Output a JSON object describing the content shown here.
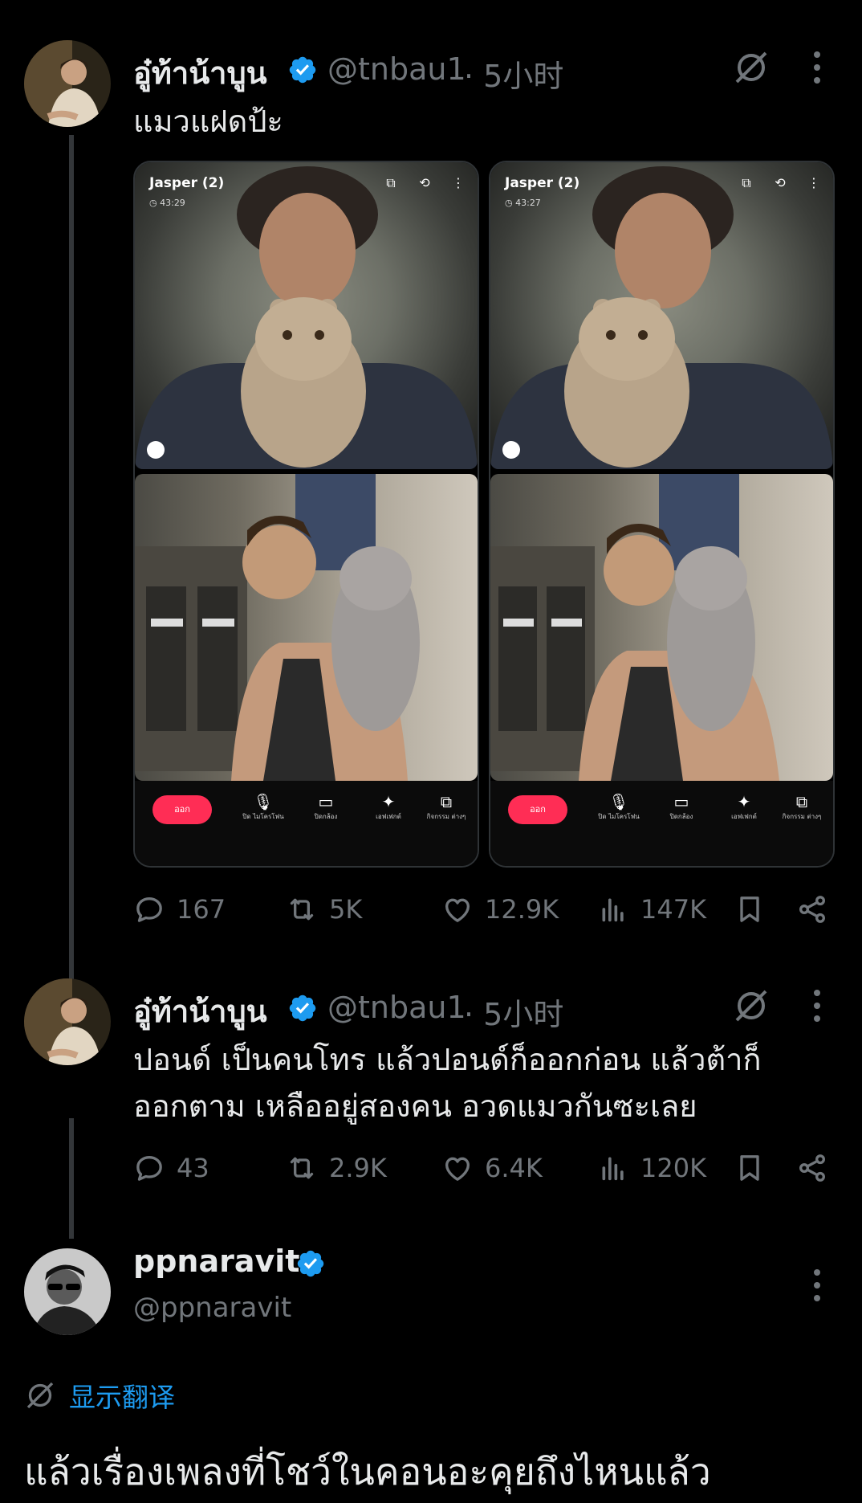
{
  "tweet1": {
    "author_name": "อู๋ท้าน้าบูน",
    "handle": "@tnbau1",
    "time": "· 5小时",
    "text": "แมวแฝดป้ะ",
    "media": [
      {
        "caller": "Jasper (2)",
        "timer": "43:29",
        "controls": [
          {
            "label": "ออก"
          },
          {
            "label": "ปิด ไมโครโฟน"
          },
          {
            "label": "ปิดกล้อง"
          },
          {
            "label": "เอฟเฟกต์"
          },
          {
            "label": "กิจกรรม ต่างๆ"
          }
        ]
      },
      {
        "caller": "Jasper (2)",
        "timer": "43:27",
        "controls": [
          {
            "label": "ออก"
          },
          {
            "label": "ปิด ไมโครโฟน"
          },
          {
            "label": "ปิดกล้อง"
          },
          {
            "label": "เอฟเฟกต์"
          },
          {
            "label": "กิจกรรม ต่างๆ"
          }
        ]
      }
    ],
    "stats": {
      "replies": "167",
      "reposts": "5K",
      "likes": "12.9K",
      "views": "147K"
    }
  },
  "tweet2": {
    "author_name": "อู๋ท้าน้าบูน",
    "handle": "@tnbau1",
    "time": "· 5小时",
    "text_line1": "ปอนด์ เป็นคนโทร แล้วปอนด์ก็ออกก่อน แล้วต้าก็",
    "text_line2": "ออกตาม เหลืออยู่สองคน อวดแมวกันซะเลย",
    "stats": {
      "replies": "43",
      "reposts": "2.9K",
      "likes": "6.4K",
      "views": "120K"
    }
  },
  "reply": {
    "author_name": "ppnaravit",
    "handle": "@ppnaravit",
    "translate_label": "显示翻译",
    "text": "แล้วเรื่องเพลงที่โชว์ในคอนอะคุยถึงไหนแล้ว"
  },
  "colors": {
    "background": "#000000",
    "text_primary": "#e7e9ea",
    "text_secondary": "#71767b",
    "accent_blue": "#1d9bf0",
    "leave_red": "#ff2d55"
  },
  "icons": {
    "verified": "verified-badge-icon",
    "grok": "grok-icon",
    "more": "more-vertical-icon",
    "reply": "reply-icon",
    "repost": "repost-icon",
    "like": "like-icon",
    "views": "views-icon",
    "bookmark": "bookmark-icon",
    "share": "share-icon",
    "translate": "translate-icon"
  }
}
